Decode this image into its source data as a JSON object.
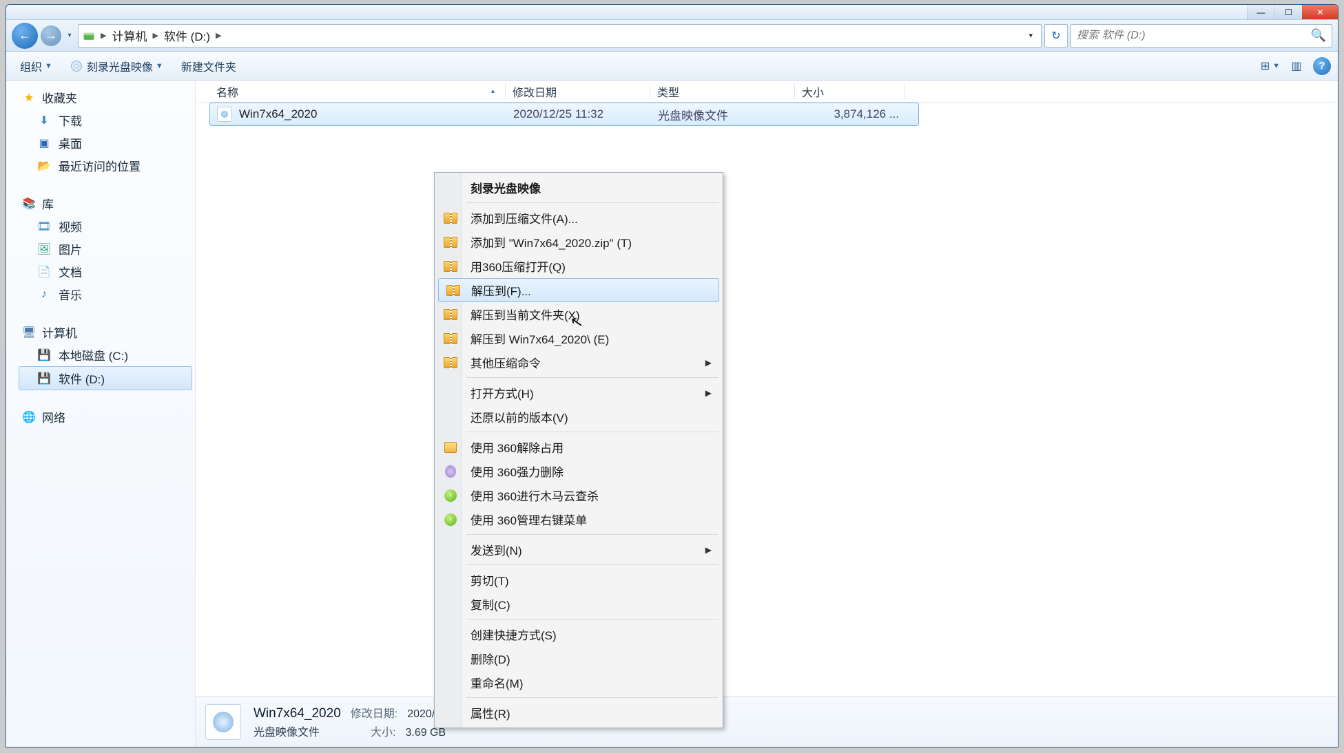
{
  "window_controls": {
    "min": "—",
    "max": "☐",
    "close": "✕"
  },
  "nav": {
    "back_glyph": "←",
    "fwd_glyph": "→",
    "recent_glyph": "▾",
    "breadcrumbs": [
      "计算机",
      "软件 (D:)"
    ],
    "addr_drop": "▾",
    "refresh_glyph": "↻",
    "search_placeholder": "搜索 软件 (D:)",
    "search_icon": "🔍"
  },
  "toolbar": {
    "organize": "组织",
    "burn": "刻录光盘映像",
    "new_folder": "新建文件夹",
    "drop": "▼",
    "view_glyph": "☰",
    "preview_glyph": "▥",
    "help_glyph": "?"
  },
  "sidebar": {
    "favorites": {
      "head": "收藏夹",
      "items": [
        "下载",
        "桌面",
        "最近访问的位置"
      ]
    },
    "libraries": {
      "head": "库",
      "items": [
        "视频",
        "图片",
        "文档",
        "音乐"
      ]
    },
    "computer": {
      "head": "计算机",
      "items": [
        "本地磁盘 (C:)",
        "软件 (D:)"
      ]
    },
    "network": {
      "head": "网络"
    }
  },
  "columns": {
    "name": "名称",
    "date": "修改日期",
    "type": "类型",
    "size": "大小",
    "sort_glyph": "▴"
  },
  "files": [
    {
      "name": "Win7x64_2020",
      "date": "2020/12/25 11:32",
      "type": "光盘映像文件",
      "size": "3,874,126 ..."
    }
  ],
  "context_menu": {
    "burn": "刻录光盘映像",
    "add_archive": "添加到压缩文件(A)...",
    "add_zip": "添加到 \"Win7x64_2020.zip\" (T)",
    "open_360zip": "用360压缩打开(Q)",
    "extract_to": "解压到(F)...",
    "extract_here": "解压到当前文件夹(X)",
    "extract_dir": "解压到 Win7x64_2020\\ (E)",
    "other_zip": "其他压缩命令",
    "open_with": "打开方式(H)",
    "restore_prev": "还原以前的版本(V)",
    "unlock_360": "使用 360解除占用",
    "force_del": "使用 360强力删除",
    "cloud_scan": "使用 360进行木马云查杀",
    "manage_ctx": "使用 360管理右键菜单",
    "send_to": "发送到(N)",
    "cut": "剪切(T)",
    "copy": "复制(C)",
    "shortcut": "创建快捷方式(S)",
    "delete": "删除(D)",
    "rename": "重命名(M)",
    "properties": "属性(R)",
    "sub_glyph": "▶"
  },
  "details": {
    "name": "Win7x64_2020",
    "date_label": "修改日期:",
    "date": "2020/12/25 11:32",
    "type": "光盘映像文件",
    "size_label": "大小:",
    "size": "3.69 GB"
  }
}
